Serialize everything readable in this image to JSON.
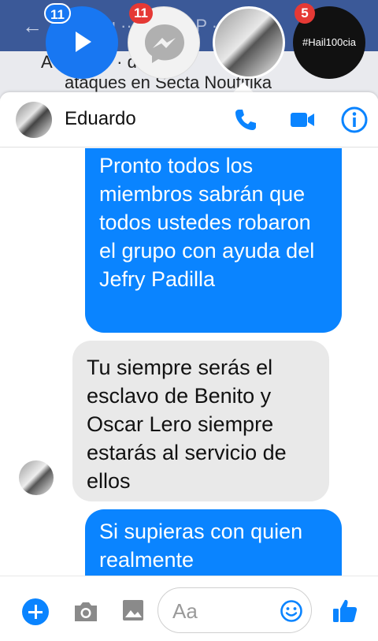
{
  "background": {
    "back_arrow": "←",
    "top_title": "Au  ··· strada  P  ···  de",
    "post_line1": "A  istr   P    ··   ·  do",
    "post_line2": "ataques en Secta  Noutifika"
  },
  "chat_heads": [
    {
      "name": "video",
      "badge": "11",
      "icon": "play-icon"
    },
    {
      "name": "messenger",
      "badge": "11",
      "icon": "messenger-icon"
    },
    {
      "name": "photo-contact",
      "icon": "avatar"
    },
    {
      "name": "hail100cia",
      "badge": "5",
      "label": "#Hail100cia"
    }
  ],
  "header": {
    "contact_name": "Eduardo",
    "icons": [
      "phone-icon",
      "video-camera-icon",
      "info-icon"
    ],
    "accent": "#0a84ff"
  },
  "messages": [
    {
      "direction": "outgoing",
      "text": "Pronto todos los miembros sabrán que todos ustedes robaron el grupo con ayuda del Jefry Padilla"
    },
    {
      "direction": "incoming",
      "text": "Tu siempre serás el esclavo de Benito y Oscar Lero siempre estarás al servicio de ellos"
    },
    {
      "direction": "outgoing",
      "text": "Si supieras con quien realmente"
    }
  ],
  "composer": {
    "placeholder": "Aa",
    "icons": [
      "add-icon",
      "camera-icon",
      "gallery-icon",
      "emoji-icon",
      "thumbs-up-icon"
    ]
  },
  "colors": {
    "outgoing_bubble": "#0a84ff",
    "incoming_bubble": "#e9e9e9",
    "badge_red": "#e53935",
    "facebook_blue": "#3b5998"
  }
}
